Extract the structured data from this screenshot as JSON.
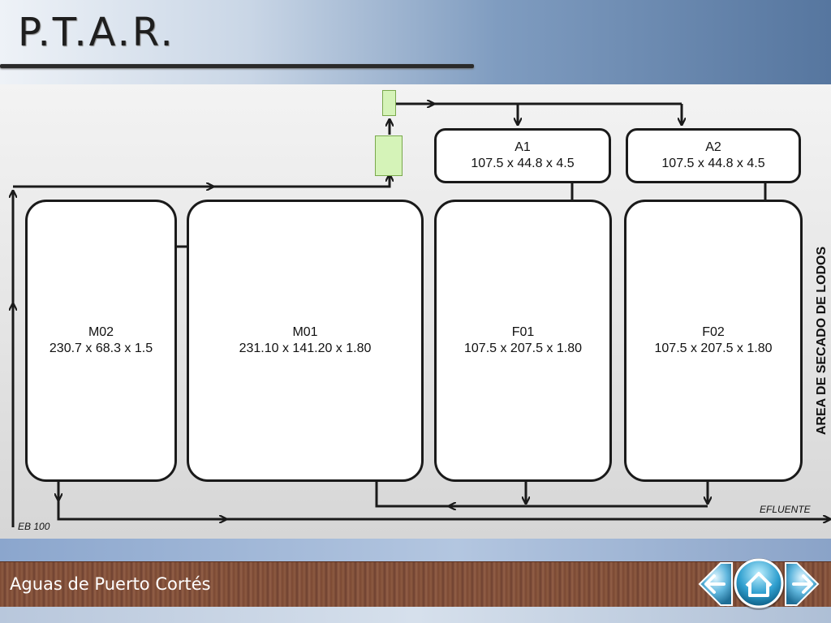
{
  "slide": {
    "title": "P.T.A.R.",
    "footer": "Aguas de Puerto Cortés"
  },
  "diagram": {
    "tanks": [
      {
        "id": "M02",
        "name": "M02",
        "dims": "230.7 x 68.3 x 1.5"
      },
      {
        "id": "M01",
        "name": "M01",
        "dims": "231.10 x 141.20 x 1.80"
      },
      {
        "id": "F01",
        "name": "F01",
        "dims": "107.5 x 207.5 x 1.80"
      },
      {
        "id": "F02",
        "name": "F02",
        "dims": "107.5 x 207.5 x 1.80"
      }
    ],
    "aboxes": [
      {
        "id": "A1",
        "name": "A1",
        "dims": "107.5 x 44.8 x 4.5"
      },
      {
        "id": "A2",
        "name": "A2",
        "dims": "107.5 x 44.8 x 4.5"
      }
    ],
    "side_label": "AREA DE SECADO DE LODOS",
    "eb_label": "EB 100",
    "effluent_label": "EFLUENTE"
  },
  "nav": {
    "icons": [
      "back-arrow-icon",
      "home-icon",
      "forward-arrow-icon"
    ]
  },
  "colors": {
    "green_box": "#d5f3b8",
    "line": "#1a1a1a"
  }
}
